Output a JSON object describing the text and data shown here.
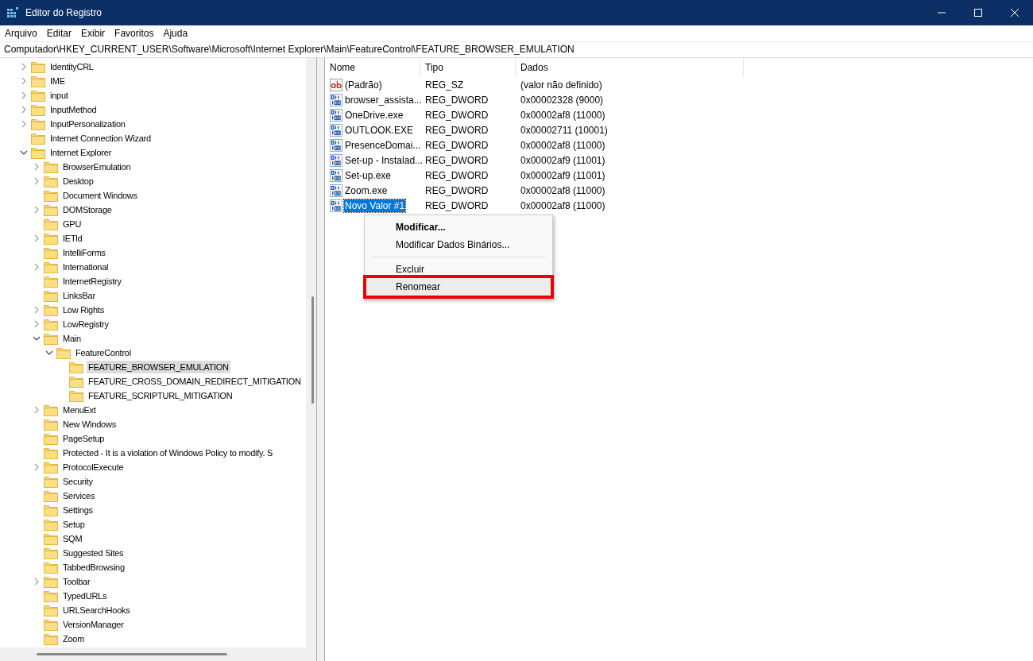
{
  "window": {
    "title": "Editor do Registro"
  },
  "menu": [
    "Arquivo",
    "Editar",
    "Exibir",
    "Favoritos",
    "Ajuda"
  ],
  "address": "Computador\\HKEY_CURRENT_USER\\Software\\Microsoft\\Internet Explorer\\Main\\FeatureControl\\FEATURE_BROWSER_EMULATION",
  "tree": [
    {
      "label": "IdentityCRL",
      "expanded": false,
      "selected": false
    },
    {
      "label": "IME",
      "expanded": false,
      "selected": false
    },
    {
      "label": "input",
      "expanded": false,
      "selected": false
    },
    {
      "label": "InputMethod",
      "expanded": false,
      "selected": false
    },
    {
      "label": "InputPersonalization",
      "expanded": false,
      "selected": false
    },
    {
      "label": "Internet Connection Wizard",
      "selected": false
    },
    {
      "label": "Internet Explorer",
      "expanded": true,
      "selected": false,
      "children": [
        {
          "label": "BrowserEmulation",
          "expanded": false,
          "selected": false
        },
        {
          "label": "Desktop",
          "expanded": false,
          "selected": false
        },
        {
          "label": "Document Windows",
          "selected": false
        },
        {
          "label": "DOMStorage",
          "expanded": false,
          "selected": false
        },
        {
          "label": "GPU",
          "selected": false
        },
        {
          "label": "IETld",
          "expanded": false,
          "selected": false
        },
        {
          "label": "IntelliForms",
          "selected": false
        },
        {
          "label": "International",
          "expanded": false,
          "selected": false
        },
        {
          "label": "InternetRegistry",
          "selected": false
        },
        {
          "label": "LinksBar",
          "selected": false
        },
        {
          "label": "Low Rights",
          "expanded": false,
          "selected": false
        },
        {
          "label": "LowRegistry",
          "expanded": false,
          "selected": false
        },
        {
          "label": "Main",
          "expanded": true,
          "selected": false,
          "children": [
            {
              "label": "FeatureControl",
              "expanded": true,
              "selected": false,
              "children": [
                {
                  "label": "FEATURE_BROWSER_EMULATION",
                  "selected": true
                },
                {
                  "label": "FEATURE_CROSS_DOMAIN_REDIRECT_MITIGATION",
                  "selected": false
                },
                {
                  "label": "FEATURE_SCRIPTURL_MITIGATION",
                  "selected": false
                }
              ]
            }
          ]
        },
        {
          "label": "MenuExt",
          "expanded": false,
          "selected": false
        },
        {
          "label": "New Windows",
          "selected": false
        },
        {
          "label": "PageSetup",
          "selected": false
        },
        {
          "label": "Protected - It is a violation of Windows Policy to modify. S",
          "selected": false
        },
        {
          "label": "ProtocolExecute",
          "expanded": false,
          "selected": false
        },
        {
          "label": "Security",
          "selected": false
        },
        {
          "label": "Services",
          "selected": false
        },
        {
          "label": "Settings",
          "selected": false
        },
        {
          "label": "Setup",
          "selected": false
        },
        {
          "label": "SQM",
          "selected": false
        },
        {
          "label": "Suggested Sites",
          "selected": false
        },
        {
          "label": "TabbedBrowsing",
          "selected": false
        },
        {
          "label": "Toolbar",
          "expanded": false,
          "selected": false
        },
        {
          "label": "TypedURLs",
          "selected": false
        },
        {
          "label": "URLSearchHooks",
          "selected": false
        },
        {
          "label": "VersionManager",
          "selected": false
        },
        {
          "label": "Zoom",
          "selected": false
        }
      ]
    }
  ],
  "table": {
    "columns": [
      "Nome",
      "Tipo",
      "Dados"
    ],
    "rows": [
      {
        "kind": "string",
        "name": "(Padrão)",
        "type": "REG_SZ",
        "data": "(valor não definido)",
        "selected": false
      },
      {
        "kind": "binary",
        "name": "browser_assista...",
        "type": "REG_DWORD",
        "data": "0x00002328 (9000)",
        "selected": false
      },
      {
        "kind": "binary",
        "name": "OneDrive.exe",
        "type": "REG_DWORD",
        "data": "0x00002af8 (11000)",
        "selected": false
      },
      {
        "kind": "binary",
        "name": "OUTLOOK.EXE",
        "type": "REG_DWORD",
        "data": "0x00002711 (10001)",
        "selected": false
      },
      {
        "kind": "binary",
        "name": "PresenceDomai...",
        "type": "REG_DWORD",
        "data": "0x00002af8 (11000)",
        "selected": false
      },
      {
        "kind": "binary",
        "name": "Set-up - Instalad...",
        "type": "REG_DWORD",
        "data": "0x00002af9 (11001)",
        "selected": false
      },
      {
        "kind": "binary",
        "name": "Set-up.exe",
        "type": "REG_DWORD",
        "data": "0x00002af9 (11001)",
        "selected": false
      },
      {
        "kind": "binary",
        "name": "Zoom.exe",
        "type": "REG_DWORD",
        "data": "0x00002af8 (11000)",
        "selected": false
      },
      {
        "kind": "binary",
        "name": "Novo Valor #1",
        "type": "REG_DWORD",
        "data": "0x00002af8 (11000)",
        "selected": true
      }
    ]
  },
  "context_menu": [
    {
      "kind": "item",
      "label": "Modificar...",
      "default": true,
      "hovered": false,
      "annotated": false
    },
    {
      "kind": "item",
      "label": "Modificar Dados Binários...",
      "default": false,
      "hovered": false,
      "annotated": false
    },
    {
      "kind": "separator"
    },
    {
      "kind": "item",
      "label": "Excluir",
      "default": false,
      "hovered": false,
      "annotated": false
    },
    {
      "kind": "item",
      "label": "Renomear",
      "default": false,
      "hovered": true,
      "annotated": true
    }
  ]
}
